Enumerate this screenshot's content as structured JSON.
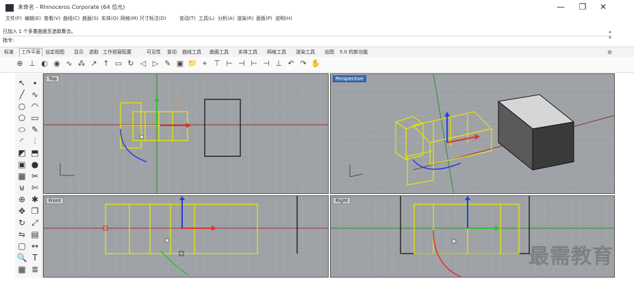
{
  "window": {
    "title": "未命名 - Rhinoceros Corporate (64 位元)",
    "minimize": "—",
    "maximize": "❐",
    "close": "✕"
  },
  "menu": [
    "文件(F)",
    "编辑(E)",
    "查看(V)",
    "曲线(C)",
    "曲面(S)",
    "实体(O)",
    "网格(M)",
    "尺寸标注(D)",
    "变动(T)",
    "工具(L)",
    "分析(A)",
    "渲染(R)",
    "面板(P)",
    "说明(H)"
  ],
  "command": {
    "history": "已加入 1 个多重曲面至选取集合。",
    "prompt": "指令: "
  },
  "tabs": [
    "标准",
    "工作平面",
    "设定视图",
    "显示",
    "选取",
    "工作视窗配置",
    "可见性",
    "变动",
    "曲线工具",
    "曲面工具",
    "实体工具",
    "网格工具",
    "渲染工具",
    "出图",
    "5.0 的新功能"
  ],
  "active_tab": "工作平面",
  "toolbar_icons": [
    "cplane-world-icon",
    "cplane-origin-icon",
    "cplane-elevation-icon",
    "cplane-object-icon",
    "cplane-curve-icon",
    "cplane-3point-icon",
    "cplane-x-axis-icon",
    "cplane-z-axis-icon",
    "cplane-view-icon",
    "cplane-rotate-icon",
    "cplane-previous-icon",
    "cplane-next-icon",
    "named-cplane-icon",
    "save-icon",
    "folder-icon",
    "set-view-icon",
    "cplane-top-icon",
    "cplane-front-icon",
    "cplane-right-icon",
    "cplane-back-icon",
    "cplane-left-icon",
    "cplane-bottom-icon",
    "cplane-undo-icon",
    "cplane-redo-icon",
    "pointer-icon"
  ],
  "left_icons": [
    "select-icon",
    "point-icon",
    "polyline-icon",
    "curve-icon",
    "circle-icon",
    "arc-icon",
    "polygon-icon",
    "rectangle-icon",
    "ellipse-icon",
    "freeform-icon",
    "fillet-icon",
    "offset-icon",
    "surface-icon",
    "extrude-icon",
    "solid-box-icon",
    "sphere-icon",
    "mesh-icon",
    "split-icon",
    "boolean-icon",
    "trim-icon",
    "join-icon",
    "explode-icon",
    "move-icon",
    "copy-icon",
    "rotate-icon",
    "scale-icon",
    "mirror-icon",
    "array-icon",
    "group-icon",
    "dimension-icon",
    "zoom-icon",
    "text-icon",
    "grid-icon",
    "layer-icon"
  ],
  "viewports": {
    "top": "Top",
    "perspective": "Perspective",
    "front": "Front",
    "right": "Right"
  },
  "watermark": "最需教育",
  "colors": {
    "viewport_bg": "#9ea2a6",
    "grid": "#b0b4b8",
    "selection": "#e6e600",
    "x_axis": "#e03030",
    "y_axis": "#30c030",
    "z_axis": "#2040e0"
  }
}
